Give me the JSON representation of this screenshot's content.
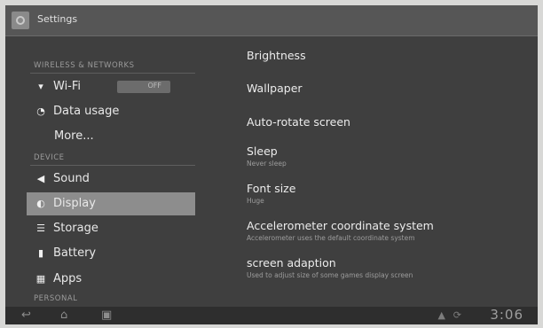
{
  "actionbar": {
    "title": "Settings",
    "app_icon": "settings-gear-icon"
  },
  "sidebar": {
    "sections": [
      {
        "header": "WIRELESS & NETWORKS"
      },
      {
        "header": "DEVICE"
      },
      {
        "header": "PERSONAL"
      }
    ],
    "items": [
      {
        "label": "Wi-Fi",
        "icon": "wifi-icon",
        "toggle": "OFF"
      },
      {
        "label": "Data usage",
        "icon": "data-usage-icon"
      },
      {
        "label": "More..."
      },
      {
        "label": "Sound",
        "icon": "speaker-icon"
      },
      {
        "label": "Display",
        "icon": "display-icon",
        "selected": true
      },
      {
        "label": "Storage",
        "icon": "storage-icon"
      },
      {
        "label": "Battery",
        "icon": "battery-icon"
      },
      {
        "label": "Apps",
        "icon": "apps-icon"
      }
    ]
  },
  "display_settings": [
    {
      "title": "Brightness",
      "summary": ""
    },
    {
      "title": "Wallpaper",
      "summary": ""
    },
    {
      "title": "Auto-rotate screen",
      "summary": ""
    },
    {
      "title": "Sleep",
      "summary": "Never sleep"
    },
    {
      "title": "Font size",
      "summary": "Huge"
    },
    {
      "title": "Accelerometer coordinate system",
      "summary": "Accelerometer uses the default coordinate system"
    },
    {
      "title": "screen adaption",
      "summary": "Used to adjust size of some games display screen"
    }
  ],
  "system_bar": {
    "buttons": [
      "back-icon",
      "home-icon",
      "recent-apps-icon"
    ],
    "clock": "3:06"
  },
  "colors": {
    "background": "#3f3f3f",
    "actionbar": "#565656",
    "selected": "#8d8d8d"
  }
}
